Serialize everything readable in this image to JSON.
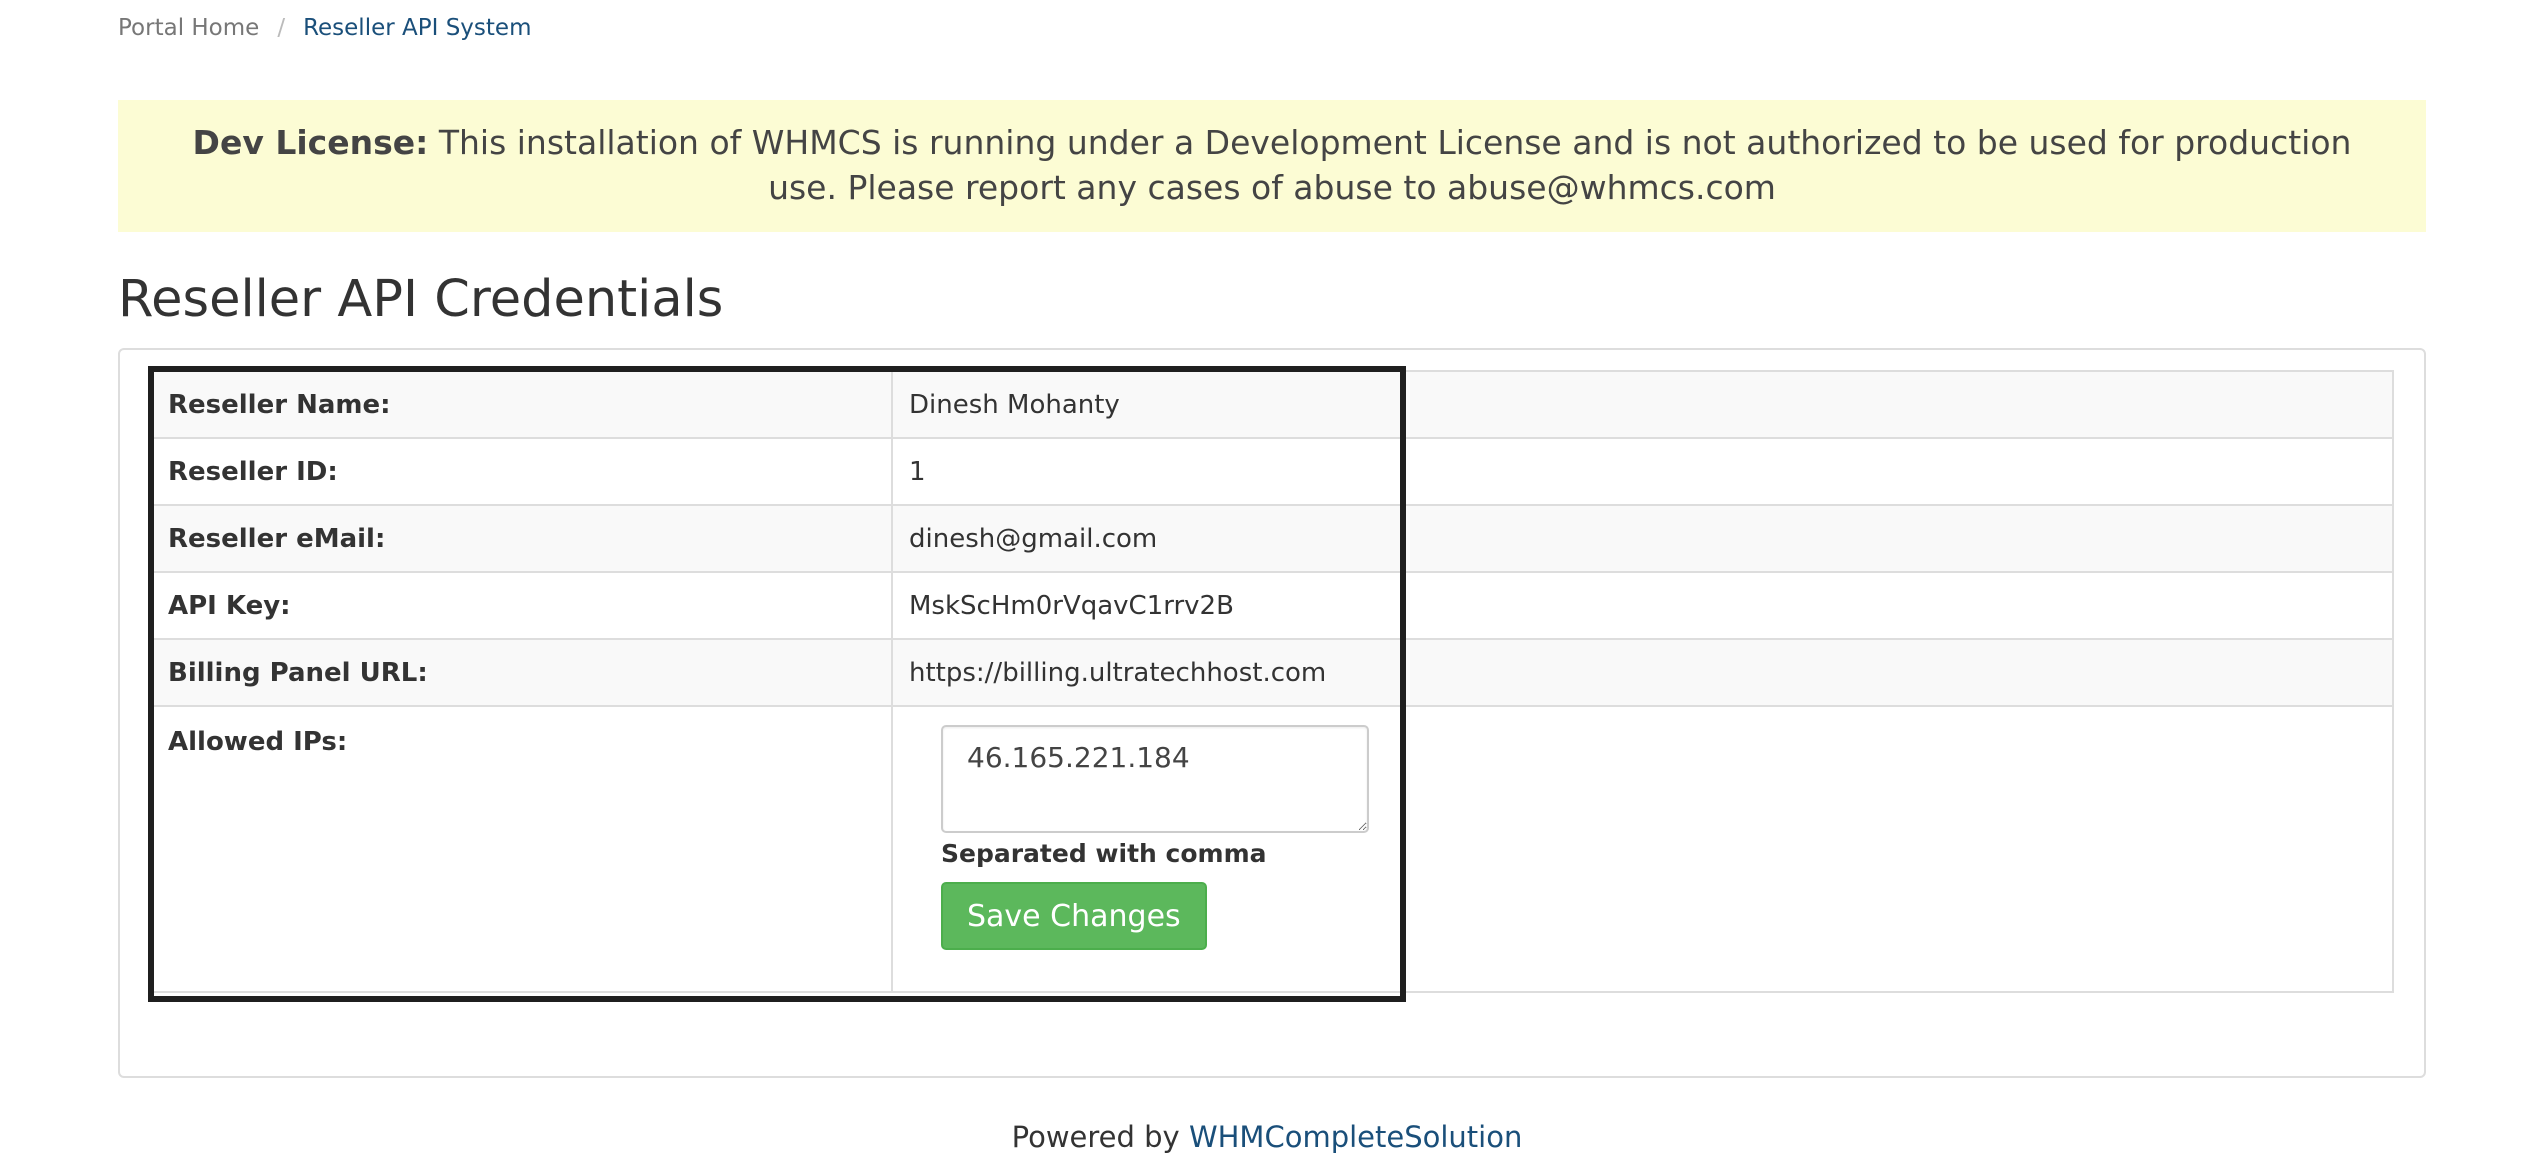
{
  "breadcrumb": {
    "home": "Portal Home",
    "separator": "/",
    "current": "Reseller API System"
  },
  "alert": {
    "label": "Dev License:",
    "message": "This installation of WHMCS is running under a Development License and is not authorized to be used for production use. Please report any cases of abuse to abuse@whmcs.com"
  },
  "page_title": "Reseller API Credentials",
  "credentials": [
    {
      "label": "Reseller Name:",
      "value": "Dinesh Mohanty"
    },
    {
      "label": "Reseller ID:",
      "value": "1"
    },
    {
      "label": "Reseller eMail:",
      "value": "dinesh@gmail.com"
    },
    {
      "label": "API Key:",
      "value": "MskScHm0rVqavC1rrv2B"
    },
    {
      "label": "Billing Panel URL:",
      "value": "https://billing.ultratechhost.com"
    }
  ],
  "allowed_ips": {
    "label": "Allowed IPs:",
    "value": "46.165.221.184",
    "help": "Separated with comma",
    "save_label": "Save Changes"
  },
  "footer": {
    "prefix": "Powered by ",
    "link": "WHMCompleteSolution"
  },
  "colors": {
    "alert_bg": "#fcfcd4",
    "link": "#1a4f7a",
    "button": "#5cb85c"
  }
}
